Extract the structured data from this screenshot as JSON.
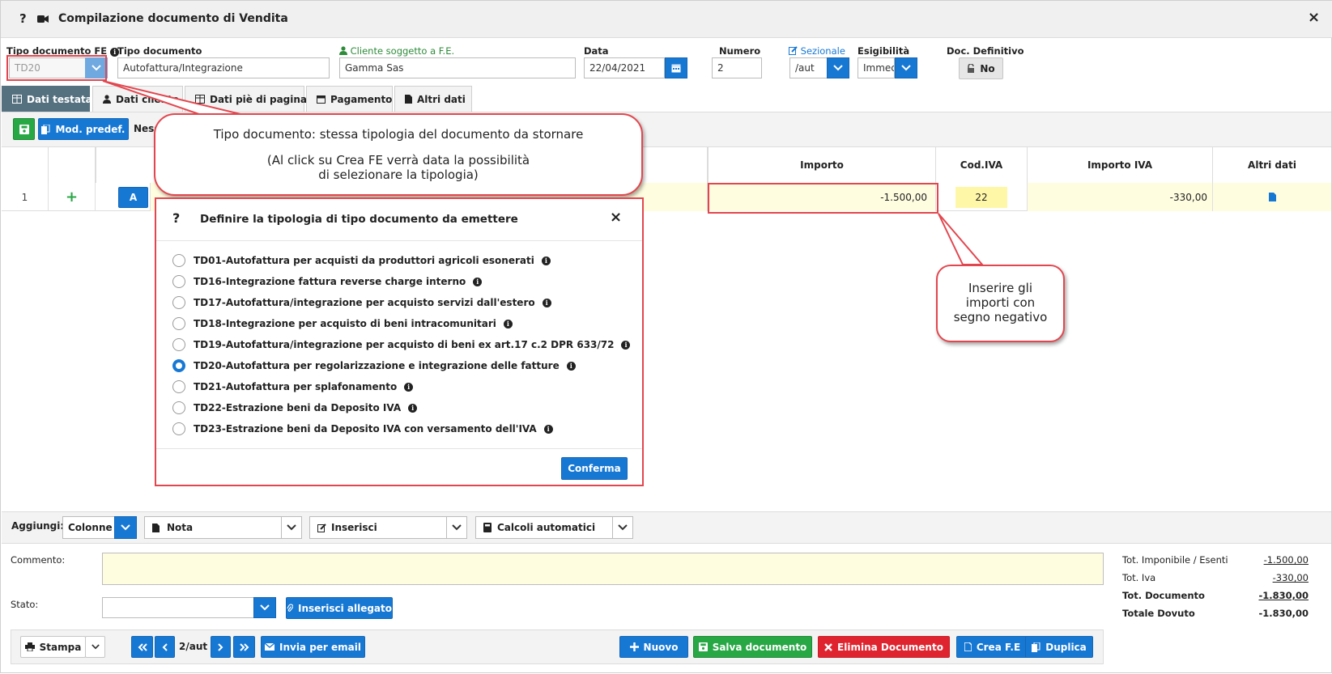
{
  "window": {
    "title": "Compilazione documento di Vendita",
    "help_glyph": "?",
    "close_glyph": "×"
  },
  "header": {
    "tipo_fe_label": "Tipo documento FE",
    "tipo_fe_value": "TD20",
    "tipo_doc_label": "Tipo documento",
    "tipo_doc_value": "Autofattura/Integrazione",
    "cliente_label": "Cliente soggetto a F.E.",
    "cliente_value": "Gamma Sas",
    "data_label": "Data",
    "data_value": "22/04/2021",
    "numero_label": "Numero",
    "numero_value": "2",
    "sezionale_label": "Sezionale",
    "sezionale_value": "/aut",
    "esigibilita_label": "Esigibilità",
    "esigibilita_value": "Immec",
    "definitivo_label": "Doc. Definitivo",
    "definitivo_value": "No"
  },
  "tabs": [
    "Dati testata",
    "Dati cliente",
    "Dati piè di pagina",
    "Pagamento",
    "Altri dati"
  ],
  "toolbar": {
    "mod_predef": "Mod. predef.",
    "nessun": "Ness"
  },
  "table": {
    "headers": {
      "importo": "Importo",
      "cod_iva": "Cod.IVA",
      "importo_iva": "Importo IVA",
      "altri_dati": "Altri dati"
    },
    "row": {
      "num": "1",
      "plus": "+",
      "a_btn": "A",
      "importo": "-1.500,00",
      "cod_iva": "22",
      "importo_iva": "-330,00"
    }
  },
  "callouts": {
    "top_line1": "Tipo documento: stessa tipologia del documento da stornare",
    "top_line2": "(Al click su Crea FE verrà data la possibilità",
    "top_line3": "di selezionare la tipologia)",
    "right_line1": "Inserire gli",
    "right_line2": "importi con",
    "right_line3": "segno negativo"
  },
  "modal": {
    "title": "Definire la tipologia di tipo documento da emettere",
    "confirm": "Conferma",
    "selected_index": 5,
    "options": [
      "TD01-Autofattura per acquisti da produttori agricoli esonerati",
      "TD16-Integrazione fattura reverse charge interno",
      "TD17-Autofattura/integrazione per acquisto servizi dall'estero",
      "TD18-Integrazione per acquisto di beni intracomunitari",
      "TD19-Autofattura/integrazione per acquisto di beni ex art.17 c.2 DPR 633/72",
      "TD20-Autofattura per regolarizzazione e integrazione delle fatture",
      "TD21-Autofattura per splafonamento",
      "TD22-Estrazione beni da Deposito IVA",
      "TD23-Estrazione beni da Deposito IVA con versamento dell'IVA"
    ]
  },
  "aggiungi": {
    "label": "Aggiungi:",
    "colonne": "Colonne",
    "nota": "Nota",
    "inserisci": "Inserisci",
    "calcoli": "Calcoli automatici"
  },
  "footer": {
    "commento_label": "Commento:",
    "stato_label": "Stato:",
    "allegato": "Inserisci allegato",
    "totals": [
      {
        "label": "Tot. Imponibile / Esenti",
        "value": "-1.500,00"
      },
      {
        "label": "Tot. Iva",
        "value": "-330,00"
      },
      {
        "label": "Tot. Documento",
        "value": "-1.830,00"
      },
      {
        "label": "Totale Dovuto",
        "value": "-1.830,00"
      }
    ]
  },
  "bottombar": {
    "stampa": "Stampa",
    "page": "2/aut",
    "email": "Invia per email",
    "nuovo": "Nuovo",
    "salva": "Salva documento",
    "elimina": "Elimina Documento",
    "crea": "Crea F.E",
    "duplica": "Duplica"
  },
  "colors": {
    "accent": "#1778d4",
    "green": "#28a745",
    "red": "#e0242f",
    "tab_active": "#55707f",
    "highlight_yellow": "#fffde0",
    "callout_border": "#e2474f"
  }
}
